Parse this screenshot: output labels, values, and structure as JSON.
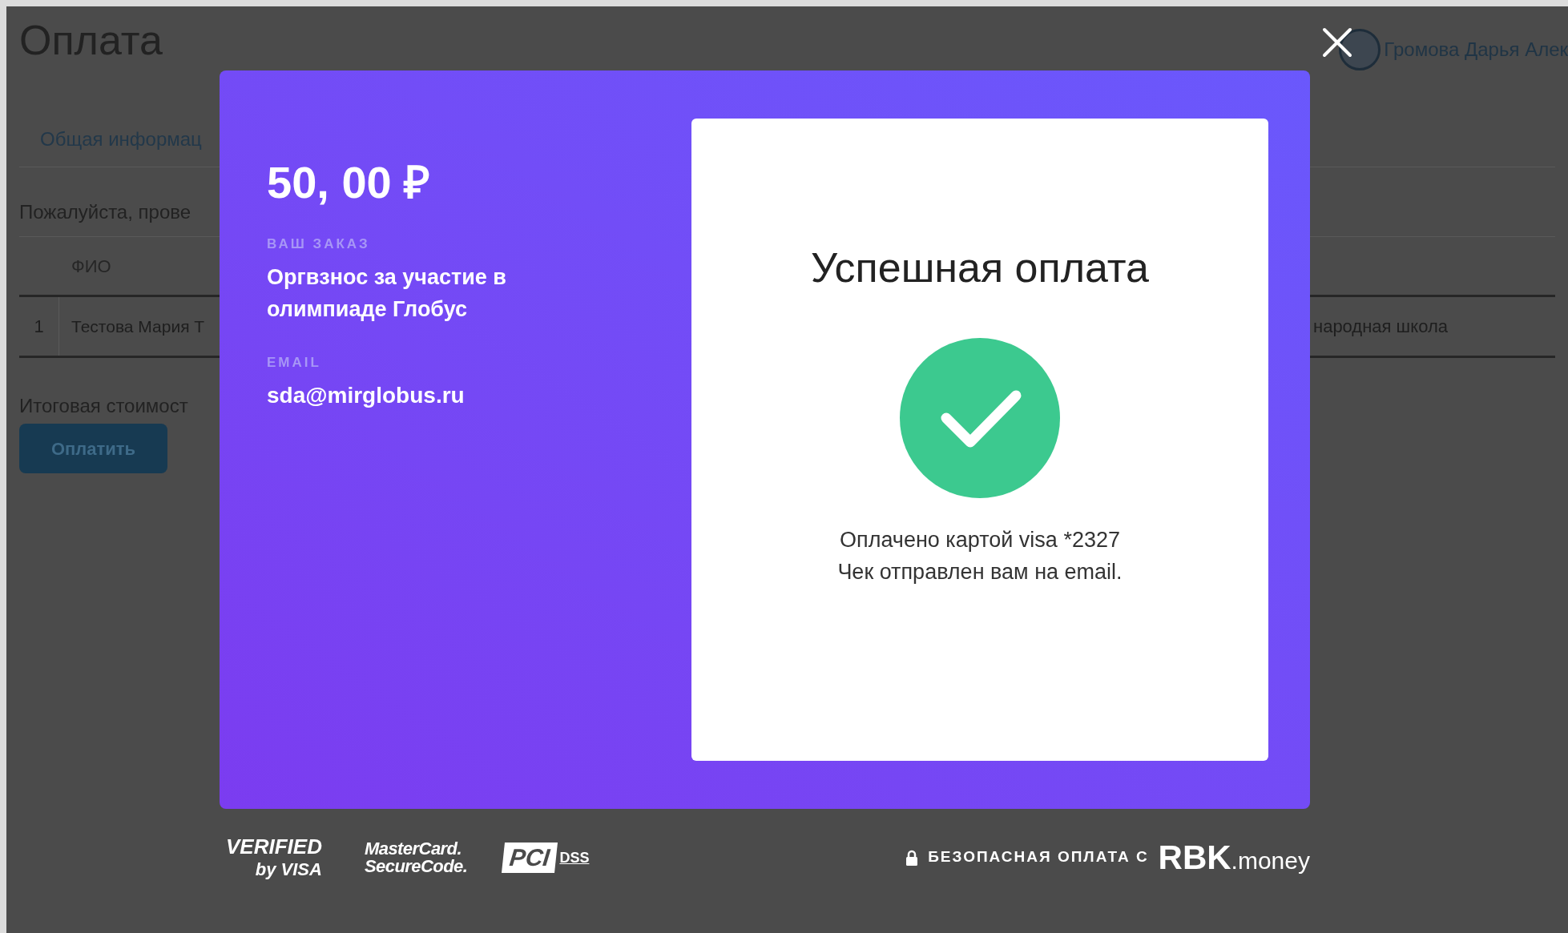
{
  "page": {
    "title": "Оплата",
    "tab": "Общая информац",
    "notice": "Пожалуйста, прове",
    "user_name": "Громова Дарья Алек",
    "table": {
      "columns": [
        "",
        "ФИО"
      ],
      "rows": [
        {
          "cells": [
            "1",
            "Тестова Мария Т"
          ],
          "tail": "народная школа"
        }
      ]
    },
    "total_label": "Итоговая стоимост",
    "pay_button": "Оплатить"
  },
  "payment": {
    "amount": "50, 00 ₽",
    "order_label": "ВАШ ЗАКАЗ",
    "order": "Оргвзнос за участие в олимпиаде Глобус",
    "email_label": "EMAIL",
    "email": "sda@mirglobus.ru",
    "result": {
      "title": "Успешная оплата",
      "lines": [
        "Оплачено картой visa *2327",
        "Чек отправлен вам на email."
      ]
    }
  },
  "footer": {
    "badges": [
      {
        "kind": "visa",
        "lines": [
          "VERIFIED",
          "by VISA"
        ]
      },
      {
        "kind": "mastercard",
        "lines": [
          "MasterCard.",
          "SecureCode."
        ]
      },
      {
        "kind": "pci",
        "lines": [
          "PCI",
          "DSS"
        ]
      }
    ],
    "secure_text": "БЕЗОПАСНАЯ ОПЛАТА С",
    "brand": "RBK",
    "brand_suffix": ".money"
  }
}
